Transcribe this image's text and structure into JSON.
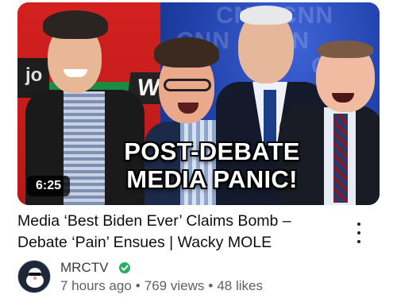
{
  "thumbnail": {
    "headline_line1": "POST-DEBATE",
    "headline_line2": "MEDIA PANIC!",
    "duration": "6:25",
    "left_sign": "jo",
    "w_sign": "W",
    "brand_watermark": "CNN"
  },
  "video": {
    "title": "Media ‘Best Biden Ever’ Claims Bomb – Debate ‘Pain’ Ensues | Wacky MOLE"
  },
  "channel": {
    "name": "MRCTV",
    "verified": true,
    "verified_color": "#27ae60"
  },
  "meta": {
    "age": "7 hours ago",
    "views": "769 views",
    "likes": "48 likes"
  },
  "icons": {
    "more": "more-vert-icon",
    "verified": "check-circle-icon"
  }
}
